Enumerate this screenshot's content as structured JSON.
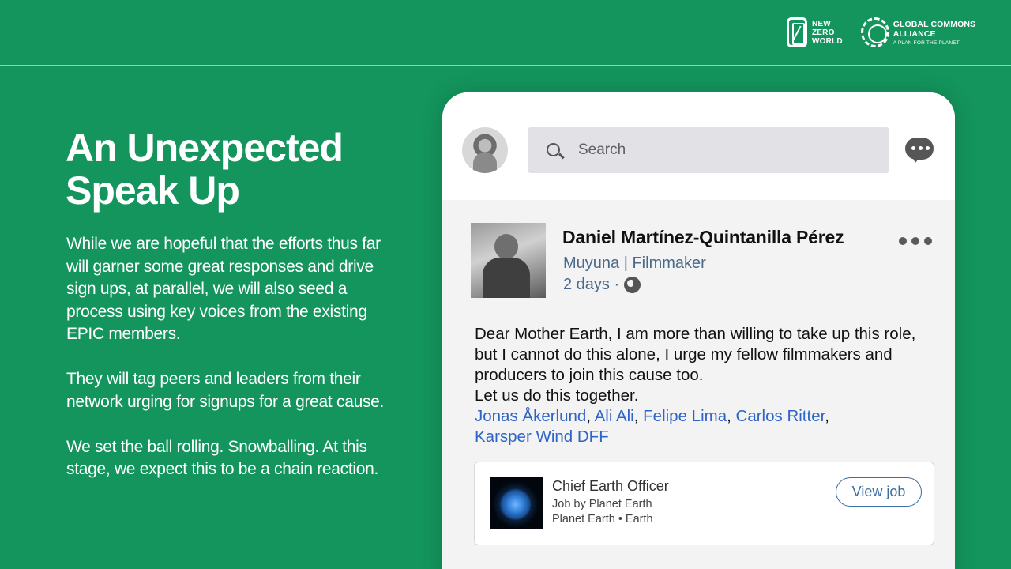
{
  "brand": {
    "nzw": {
      "line1": "NEW",
      "line2": "ZERO",
      "line3": "WORLD"
    },
    "gca": {
      "title": "GLOBAL COMMONS ALLIANCE",
      "subtitle": "A PLAN FOR THE PLANET"
    }
  },
  "slide": {
    "headline_line1": "An Unexpected",
    "headline_line2": "Speak Up",
    "paragraphs": [
      "While we are hopeful that the efforts thus far will garner some great responses and drive sign ups, at parallel, we will also seed a process using key voices from the existing EPIC members.",
      "They will tag peers and leaders from their network urging for signups for a great cause.",
      "We set the ball rolling. Snowballing. At this stage, we expect this to be a chain reaction."
    ]
  },
  "phone": {
    "search_placeholder": "Search",
    "post": {
      "author": "Daniel Martínez-Quintanilla Pérez",
      "role": "Muyuna | Filmmaker",
      "time": "2 days ·",
      "body": "Dear Mother Earth, I am more than willing to take up this role, but I cannot do this alone, I urge my fellow filmmakers and producers to join this cause too.",
      "closing": "Let us do this together.",
      "mentions": [
        "Jonas Åkerlund",
        "Ali Ali",
        "Felipe Lima",
        "Carlos Ritter",
        "Karsper Wind DFF"
      ],
      "separator": ","
    },
    "job": {
      "title": "Chief Earth Officer",
      "by": "Job by Planet Earth",
      "location": "Planet Earth • Earth",
      "cta": "View job"
    }
  },
  "colors": {
    "background": "#14955d",
    "link": "#2e64c7",
    "meta": "#4a6a8a"
  }
}
